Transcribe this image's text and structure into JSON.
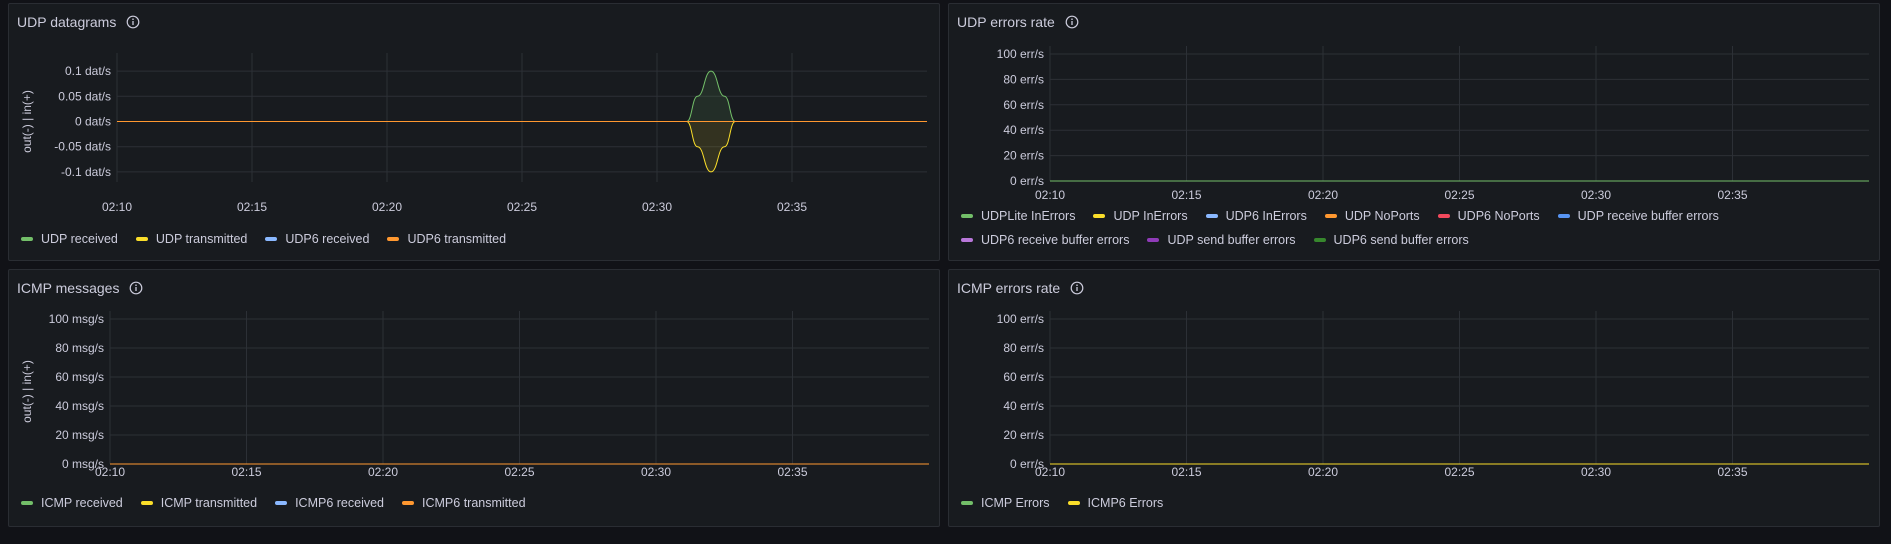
{
  "colors": {
    "green": "#73bf69",
    "yellow": "#fade2a",
    "blue": "#8ab8ff",
    "orange": "#ff9830",
    "red": "#f2495c",
    "lightblue": "#5794f2",
    "purple": "#b877d9",
    "violet": "#8f3bb8",
    "darkgreen": "#37872d",
    "grid": "#2c3036"
  },
  "icons": {
    "info": "info-circle-icon"
  },
  "panels": [
    {
      "title": "UDP datagrams",
      "legend": [
        {
          "label": "UDP received",
          "color": "#73bf69"
        },
        {
          "label": "UDP transmitted",
          "color": "#fade2a"
        },
        {
          "label": "UDP6 received",
          "color": "#8ab8ff"
        },
        {
          "label": "UDP6 transmitted",
          "color": "#ff9830"
        }
      ]
    },
    {
      "title": "UDP errors rate",
      "legend": [
        {
          "label": "UDPLite InErrors",
          "color": "#73bf69"
        },
        {
          "label": "UDP InErrors",
          "color": "#fade2a"
        },
        {
          "label": "UDP6 InErrors",
          "color": "#8ab8ff"
        },
        {
          "label": "UDP NoPorts",
          "color": "#ff9830"
        },
        {
          "label": "UDP6 NoPorts",
          "color": "#f2495c"
        },
        {
          "label": "UDP receive buffer errors",
          "color": "#5794f2"
        },
        {
          "label": "UDP6 receive buffer errors",
          "color": "#b877d9"
        },
        {
          "label": "UDP send buffer errors",
          "color": "#8f3bb8"
        },
        {
          "label": "UDP6 send buffer errors",
          "color": "#37872d"
        }
      ]
    },
    {
      "title": "ICMP messages",
      "legend": [
        {
          "label": "ICMP received",
          "color": "#73bf69"
        },
        {
          "label": "ICMP transmitted",
          "color": "#fade2a"
        },
        {
          "label": "ICMP6 received",
          "color": "#8ab8ff"
        },
        {
          "label": "ICMP6 transmitted",
          "color": "#ff9830"
        }
      ]
    },
    {
      "title": "ICMP errors rate",
      "legend": [
        {
          "label": "ICMP Errors",
          "color": "#73bf69"
        },
        {
          "label": "ICMP6 Errors",
          "color": "#fade2a"
        }
      ]
    }
  ],
  "chart_data": [
    {
      "type": "area",
      "title": "UDP datagrams",
      "ylabel": "out(-) | in(+)",
      "yticks": [
        "0.1 dat/s",
        "0.05 dat/s",
        "0 dat/s",
        "-0.05 dat/s",
        "-0.1 dat/s"
      ],
      "ytick_values": [
        0.1,
        0.05,
        0,
        -0.05,
        -0.1
      ],
      "ylim": [
        -0.12,
        0.12
      ],
      "xticks": [
        "02:10",
        "02:15",
        "02:20",
        "02:25",
        "02:30",
        "02:35"
      ],
      "xlim_minutes": [
        0,
        30
      ],
      "series": [
        {
          "name": "UDP received",
          "color": "#73bf69",
          "x": [
            0,
            21.1,
            21.5,
            22.0,
            22.5,
            22.9,
            30
          ],
          "y": [
            0,
            0,
            0.05,
            0.1,
            0.05,
            0,
            0
          ]
        },
        {
          "name": "UDP transmitted",
          "color": "#fade2a",
          "x": [
            0,
            21.1,
            21.5,
            22.0,
            22.5,
            22.9,
            30
          ],
          "y": [
            0,
            0,
            -0.05,
            -0.1,
            -0.05,
            0,
            0
          ]
        },
        {
          "name": "UDP6 received",
          "color": "#8ab8ff",
          "x": [
            0,
            30
          ],
          "y": [
            0,
            0
          ]
        },
        {
          "name": "UDP6 transmitted",
          "color": "#ff9830",
          "x": [
            0,
            30
          ],
          "y": [
            0,
            0
          ]
        }
      ]
    },
    {
      "type": "line",
      "title": "UDP errors rate",
      "ylabel": "",
      "yticks": [
        "100 err/s",
        "80 err/s",
        "60 err/s",
        "40 err/s",
        "20 err/s",
        "0 err/s"
      ],
      "ytick_values": [
        100,
        80,
        60,
        40,
        20,
        0
      ],
      "ylim": [
        0,
        100
      ],
      "xticks": [
        "02:10",
        "02:15",
        "02:20",
        "02:25",
        "02:30",
        "02:35"
      ],
      "xlim_minutes": [
        0,
        30
      ],
      "series": [
        {
          "name": "UDPLite InErrors",
          "color": "#73bf69",
          "x": [
            0,
            30
          ],
          "y": [
            0,
            0
          ]
        }
      ]
    },
    {
      "type": "line",
      "title": "ICMP messages",
      "ylabel": "out(-) | in(+)",
      "yticks": [
        "100 msg/s",
        "80 msg/s",
        "60 msg/s",
        "40 msg/s",
        "20 msg/s",
        "0 msg/s"
      ],
      "ytick_values": [
        100,
        80,
        60,
        40,
        20,
        0
      ],
      "ylim": [
        0,
        100
      ],
      "xticks": [
        "02:10",
        "02:15",
        "02:20",
        "02:25",
        "02:30",
        "02:35"
      ],
      "xlim_minutes": [
        0,
        30
      ],
      "series": [
        {
          "name": "ICMP6 transmitted",
          "color": "#ff9830",
          "x": [
            0,
            30
          ],
          "y": [
            0,
            0
          ]
        }
      ]
    },
    {
      "type": "line",
      "title": "ICMP errors rate",
      "ylabel": "",
      "yticks": [
        "100 err/s",
        "80 err/s",
        "60 err/s",
        "40 err/s",
        "20 err/s",
        "0 err/s"
      ],
      "ytick_values": [
        100,
        80,
        60,
        40,
        20,
        0
      ],
      "ylim": [
        0,
        100
      ],
      "xticks": [
        "02:10",
        "02:15",
        "02:20",
        "02:25",
        "02:30",
        "02:35"
      ],
      "xlim_minutes": [
        0,
        30
      ],
      "series": [
        {
          "name": "ICMP6 Errors",
          "color": "#fade2a",
          "x": [
            0,
            30
          ],
          "y": [
            0,
            0
          ]
        }
      ]
    }
  ]
}
